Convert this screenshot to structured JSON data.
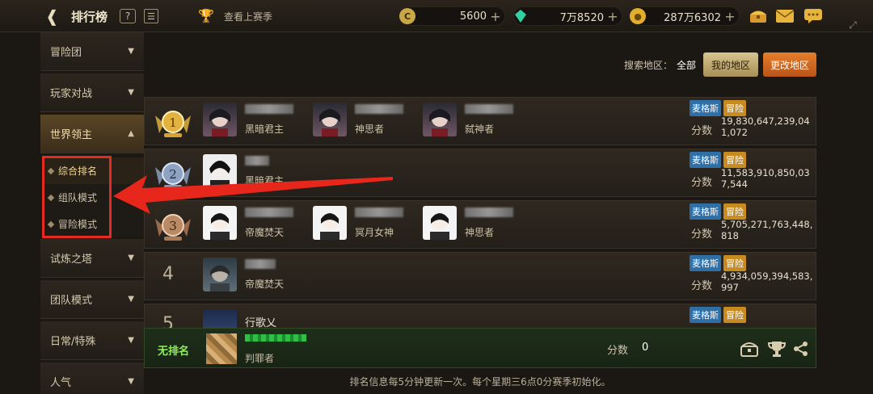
{
  "header": {
    "title": "排行榜",
    "last_season": "查看上赛季",
    "currencies": [
      {
        "icon": "gold-c-coin-icon",
        "value": "5600"
      },
      {
        "icon": "green-gem-icon",
        "value": "7万8520"
      },
      {
        "icon": "gold-coin-icon",
        "value": "287万6302"
      }
    ],
    "plus": "+"
  },
  "sidebar": {
    "items": [
      {
        "label": "冒险团"
      },
      {
        "label": "玩家对战"
      },
      {
        "label": "世界领主"
      },
      {
        "label": "试炼之塔"
      },
      {
        "label": "团队模式"
      },
      {
        "label": "日常/特殊"
      },
      {
        "label": "人气"
      }
    ],
    "sub_items": [
      {
        "label": "综合排名"
      },
      {
        "label": "组队模式"
      },
      {
        "label": "冒险模式"
      }
    ]
  },
  "region": {
    "label": "搜索地区：",
    "value": "全部",
    "my_region": "我的地区",
    "change_region": "更改地区"
  },
  "rows": [
    {
      "rank": "1",
      "members": [
        {
          "class": "黑暗君主"
        },
        {
          "class": "神思者"
        },
        {
          "class": "弑神者"
        }
      ],
      "server": "麦格斯",
      "mode": "冒险",
      "score_label": "分数",
      "score": "19,830,647,239,041,072"
    },
    {
      "rank": "2",
      "members": [
        {
          "class": "黑暗君主"
        }
      ],
      "server": "麦格斯",
      "mode": "冒险",
      "score_label": "分数",
      "score": "11,583,910,850,037,544"
    },
    {
      "rank": "3",
      "members": [
        {
          "class": "帝魔焚天"
        },
        {
          "class": "冥月女神"
        },
        {
          "class": "神思者"
        }
      ],
      "server": "麦格斯",
      "mode": "冒险",
      "score_label": "分数",
      "score": "5,705,271,763,448,818"
    },
    {
      "rank": "4",
      "members": [
        {
          "class": "帝魔焚天"
        }
      ],
      "server": "麦格斯",
      "mode": "冒险",
      "score_label": "分数",
      "score": "4,934,059,394,583,997"
    },
    {
      "rank": "5",
      "members": [
        {
          "name": "行歌乂"
        }
      ],
      "server": "麦格斯",
      "mode": "冒险"
    }
  ],
  "self": {
    "rank": "无排名",
    "class": "判罪者",
    "score_label": "分数",
    "score": "0"
  },
  "footer_note": "排名信息每5分钟更新一次。每个星期三6点0分赛季初始化。"
}
